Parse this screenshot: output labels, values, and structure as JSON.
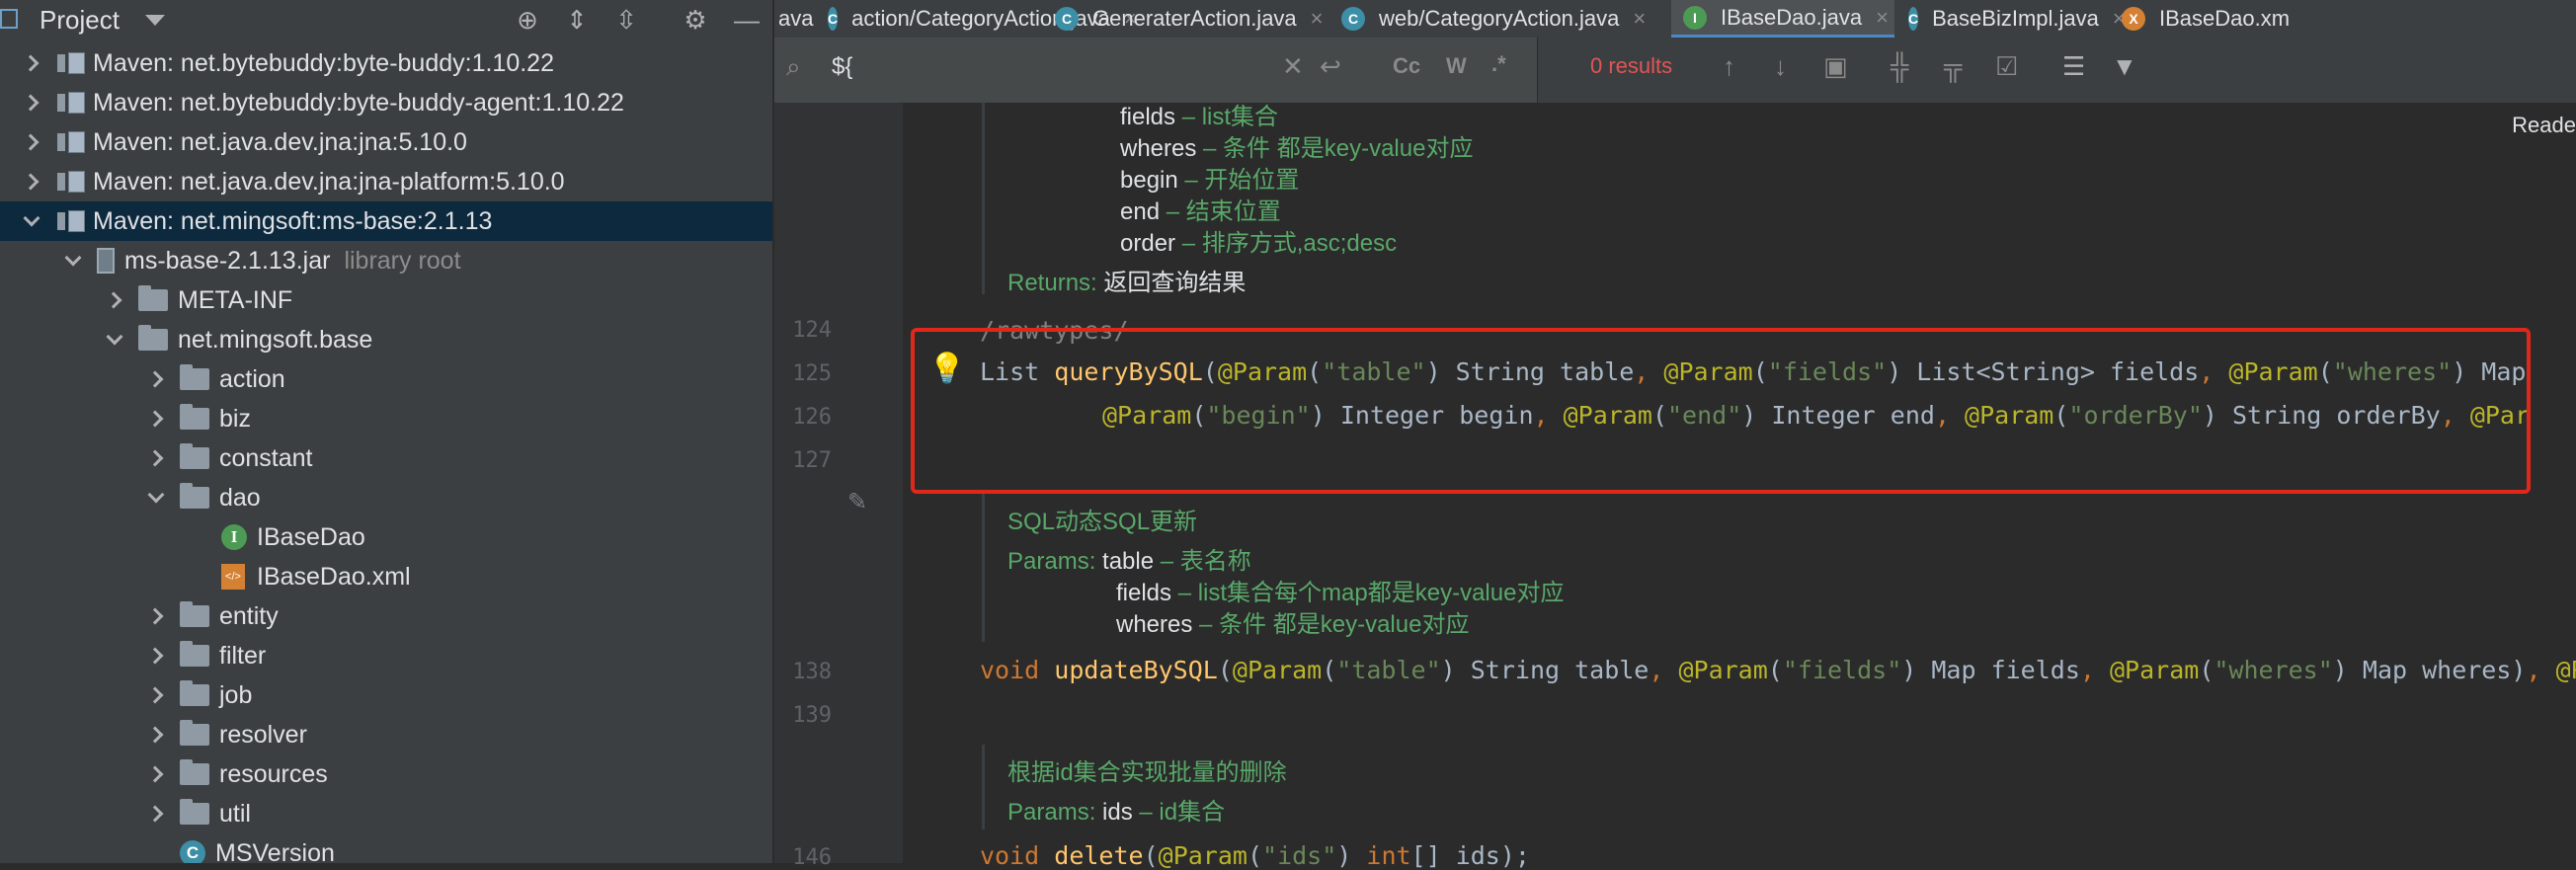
{
  "project": {
    "title": "Project",
    "tree": [
      {
        "label": "Maven: net.bytebuddy:byte-buddy:1.10.22",
        "indent": 0,
        "chev": "r",
        "icon": "lib"
      },
      {
        "label": "Maven: net.bytebuddy:byte-buddy-agent:1.10.22",
        "indent": 0,
        "chev": "r",
        "icon": "lib"
      },
      {
        "label": "Maven: net.java.dev.jna:jna:5.10.0",
        "indent": 0,
        "chev": "r",
        "icon": "lib"
      },
      {
        "label": "Maven: net.java.dev.jna:jna-platform:5.10.0",
        "indent": 0,
        "chev": "r",
        "icon": "lib"
      },
      {
        "label": "Maven: net.mingsoft:ms-base:2.1.13",
        "indent": 0,
        "chev": "d",
        "icon": "lib",
        "selected": true
      },
      {
        "label": "ms-base-2.1.13.jar",
        "extra": "library root",
        "indent": 1,
        "chev": "d",
        "icon": "jar"
      },
      {
        "label": "META-INF",
        "indent": 2,
        "chev": "r",
        "icon": "folder"
      },
      {
        "label": "net.mingsoft.base",
        "indent": 2,
        "chev": "d",
        "icon": "folder"
      },
      {
        "label": "action",
        "indent": 3,
        "chev": "r",
        "icon": "folder"
      },
      {
        "label": "biz",
        "indent": 3,
        "chev": "r",
        "icon": "folder"
      },
      {
        "label": "constant",
        "indent": 3,
        "chev": "r",
        "icon": "folder"
      },
      {
        "label": "dao",
        "indent": 3,
        "chev": "d",
        "icon": "folder"
      },
      {
        "label": "IBaseDao",
        "indent": 4,
        "chev": "",
        "icon": "iface"
      },
      {
        "label": "IBaseDao.xml",
        "indent": 4,
        "chev": "",
        "icon": "xml"
      },
      {
        "label": "entity",
        "indent": 3,
        "chev": "r",
        "icon": "folder"
      },
      {
        "label": "filter",
        "indent": 3,
        "chev": "r",
        "icon": "folder"
      },
      {
        "label": "job",
        "indent": 3,
        "chev": "r",
        "icon": "folder"
      },
      {
        "label": "resolver",
        "indent": 3,
        "chev": "r",
        "icon": "folder"
      },
      {
        "label": "resources",
        "indent": 3,
        "chev": "r",
        "icon": "folder"
      },
      {
        "label": "util",
        "indent": 3,
        "chev": "r",
        "icon": "folder"
      },
      {
        "label": "MSVersion",
        "indent": 3,
        "chev": "",
        "icon": "cls"
      }
    ]
  },
  "tabs": [
    {
      "label": "ava",
      "icon": "",
      "close": false
    },
    {
      "label": "action/CategoryAction.java",
      "icon": "C",
      "close": true
    },
    {
      "label": "GeneraterAction.java",
      "icon": "C",
      "close": true
    },
    {
      "label": "web/CategoryAction.java",
      "icon": "C",
      "close": true
    },
    {
      "label": "IBaseDao.java",
      "icon": "I",
      "close": true,
      "active": true
    },
    {
      "label": "BaseBizImpl.java",
      "icon": "C",
      "close": true
    },
    {
      "label": "IBaseDao.xm",
      "icon": "X",
      "close": false
    }
  ],
  "search": {
    "query": "${",
    "results": "0 results",
    "case_label": "Cc",
    "word_label": "W",
    "regex_label": ".*"
  },
  "reader_mode": "Reade",
  "doc1": {
    "fields_k": "fields",
    "fields_d": " – list集合",
    "wheres_k": "wheres",
    "wheres_d": " – 条件 都是key-value对应",
    "begin_k": "begin",
    "begin_d": " – 开始位置",
    "end_k": "end",
    "end_d": " – 结束位置",
    "order_k": "order",
    "order_d": " – 排序方式,asc;desc",
    "returns_k": "Returns:",
    "returns_v": " 返回查询结果"
  },
  "lines": {
    "l124": "124",
    "l125": "125",
    "l126": "126",
    "l127": "127",
    "l138": "138",
    "l139": "139",
    "l146": "146"
  },
  "code": {
    "rawtypes": "/rawtypes/",
    "l125_a": "List ",
    "l125_fn": "queryBySQL",
    "l125_b": "(",
    "l125_an1": "@Param",
    "l125_c": "(",
    "l125_s1": "\"table\"",
    "l125_d": ") String table",
    "l125_comma1": ", ",
    "l125_an2": "@Param",
    "l125_e": "(",
    "l125_s2": "\"fields\"",
    "l125_f": ") List<String> fields",
    "l125_comma2": ", ",
    "l125_an3": "@Param",
    "l125_g": "(",
    "l125_s3": "\"wheres\"",
    "l125_h": ") Map",
    "l126_an1": "@Param",
    "l126_a": "(",
    "l126_s1": "\"begin\"",
    "l126_b": ") Integer begin",
    "l126_c1": ", ",
    "l126_an2": "@Param",
    "l126_c": "(",
    "l126_s2": "\"end\"",
    "l126_d": ") Integer end",
    "l126_c2": ", ",
    "l126_an3": "@Param",
    "l126_e": "(",
    "l126_s3": "\"orderBy\"",
    "l126_f": ") String orderBy",
    "l126_c3": ", ",
    "l126_an4": "@Par",
    "l138_kw": "void ",
    "l138_fn": "updateBySQL",
    "l138_a": "(",
    "l138_an1": "@Param",
    "l138_b": "(",
    "l138_s1": "\"table\"",
    "l138_c": ") String table",
    "l138_c1": ", ",
    "l138_an2": "@Param",
    "l138_d": "(",
    "l138_s2": "\"fields\"",
    "l138_e": ") Map fields",
    "l138_c2": ", ",
    "l138_an3": "@Param",
    "l138_f": "(",
    "l138_s3": "\"wheres\"",
    "l138_g": ") Map wheres)",
    "l138_c3": ", ",
    "l138_an4": "@Par",
    "l146_kw": "void ",
    "l146_fn": "delete",
    "l146_a": "(",
    "l146_an": "@Param",
    "l146_b": "(",
    "l146_s": "\"ids\"",
    "l146_c": ") ",
    "l146_kw2": "int",
    "l146_d": "[] ids);"
  },
  "doc2": {
    "title": "SQL动态SQL更新",
    "params_k": "Params:",
    "table_v": " table",
    "table_d": " – 表名称",
    "fields_v": "fields",
    "fields_d": " – list集合每个map都是key-value对应",
    "wheres_v": "wheres",
    "wheres_d": " – 条件 都是key-value对应"
  },
  "doc3": {
    "title": "根据id集合实现批量的删除",
    "params_k": "Params:",
    "ids_v": " ids",
    "ids_d": " – id集合"
  }
}
